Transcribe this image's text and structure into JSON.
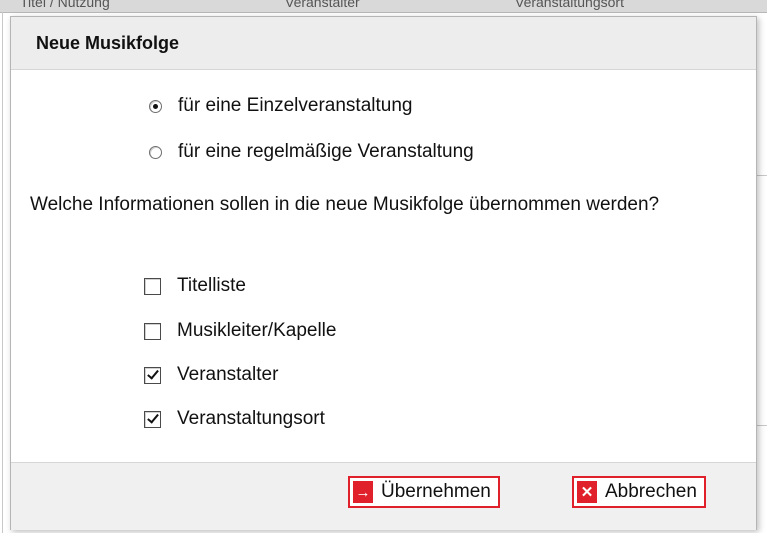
{
  "background": {
    "columns": [
      "Titel / Nutzung",
      "Veranstalter",
      "Veranstaltungsort"
    ]
  },
  "dialog": {
    "title": "Neue Musikfolge",
    "event_type": {
      "selected": "single",
      "options": [
        {
          "id": "single",
          "label": "für eine Einzelveranstaltung",
          "checked": true
        },
        {
          "id": "recurring",
          "label": "für eine regelmäßige Veranstaltung",
          "checked": false
        }
      ]
    },
    "question": "Welche Informationen sollen in die neue Musikfolge übernommen werden?",
    "checkboxes": [
      {
        "label": "Titelliste",
        "checked": false
      },
      {
        "label": "Musikleiter/Kapelle",
        "checked": false
      },
      {
        "label": "Veranstalter",
        "checked": true
      },
      {
        "label": "Veranstaltungsort",
        "checked": true
      }
    ],
    "buttons": {
      "confirm": {
        "label": "Übernehmen",
        "icon": "arrow-right-icon",
        "icon_glyph": "→"
      },
      "cancel": {
        "label": "Abbrechen",
        "icon": "close-icon",
        "icon_glyph": "✕"
      }
    },
    "colors": {
      "accent": "#e0202a",
      "header_bg": "#ededed",
      "body_bg": "#ffffff",
      "footer_bg": "#f0f0f0"
    }
  }
}
